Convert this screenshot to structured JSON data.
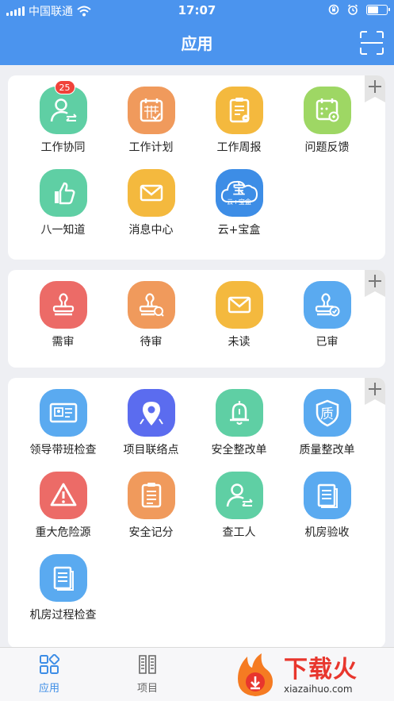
{
  "status_bar": {
    "carrier": "中国联通",
    "time": "17:07"
  },
  "header": {
    "title": "应用",
    "scan_icon": "scan-icon"
  },
  "colors": {
    "primary": "#4b94ee",
    "badge": "#f0423a"
  },
  "sections": [
    {
      "apps": [
        {
          "label": "工作协同",
          "icon": "user-transfer-icon",
          "color": "#5fcfa4",
          "badge": "25"
        },
        {
          "label": "工作计划",
          "icon": "calendar-check-icon",
          "color": "#f09a5c"
        },
        {
          "label": "工作周报",
          "icon": "clipboard-report-icon",
          "color": "#f4b93e"
        },
        {
          "label": "问题反馈",
          "icon": "calendar-search-icon",
          "color": "#9ed764"
        },
        {
          "label": "八一知道",
          "icon": "thumbs-up-icon",
          "color": "#5fcfa4"
        },
        {
          "label": "消息中心",
          "icon": "envelope-icon",
          "color": "#f4b93e"
        },
        {
          "label": "云+宝盒",
          "icon": "cloud-box-icon",
          "color": "#3d8de6",
          "icon_text": "宝",
          "icon_subtext": "云+宝盒"
        }
      ]
    },
    {
      "apps": [
        {
          "label": "需审",
          "icon": "stamp-icon",
          "color": "#ec6b67"
        },
        {
          "label": "待审",
          "icon": "stamp-search-icon",
          "color": "#f09a5c"
        },
        {
          "label": "未读",
          "icon": "envelope-icon",
          "color": "#f4b93e"
        },
        {
          "label": "已审",
          "icon": "stamp-check-icon",
          "color": "#5aaaf0"
        }
      ]
    },
    {
      "apps": [
        {
          "label": "领导带班检查",
          "icon": "id-card-icon",
          "color": "#5aaaf0"
        },
        {
          "label": "项目联络点",
          "icon": "map-pin-icon",
          "color": "#5b6cef"
        },
        {
          "label": "安全整改单",
          "icon": "bell-icon",
          "color": "#5fcfa4"
        },
        {
          "label": "质量整改单",
          "icon": "quality-shield-icon",
          "color": "#5aaaf0",
          "icon_text": "质"
        },
        {
          "label": "重大危险源",
          "icon": "warning-icon",
          "color": "#ec6b67"
        },
        {
          "label": "安全记分",
          "icon": "clipboard-list-icon",
          "color": "#f09a5c"
        },
        {
          "label": "查工人",
          "icon": "user-transfer-icon",
          "color": "#5fcfa4"
        },
        {
          "label": "机房验收",
          "icon": "document-icon",
          "color": "#5aaaf0"
        },
        {
          "label": "机房过程检查",
          "icon": "document-icon",
          "color": "#5aaaf0"
        }
      ]
    }
  ],
  "tabbar": {
    "tabs": [
      {
        "label": "应用",
        "icon": "apps-grid-icon",
        "active": true
      },
      {
        "label": "项目",
        "icon": "building-icon",
        "active": false
      }
    ],
    "active_color": "#3d8de6",
    "inactive_color": "#666666"
  },
  "watermark": {
    "title": "下载火",
    "subtitle": "xiazaihuo.com"
  }
}
